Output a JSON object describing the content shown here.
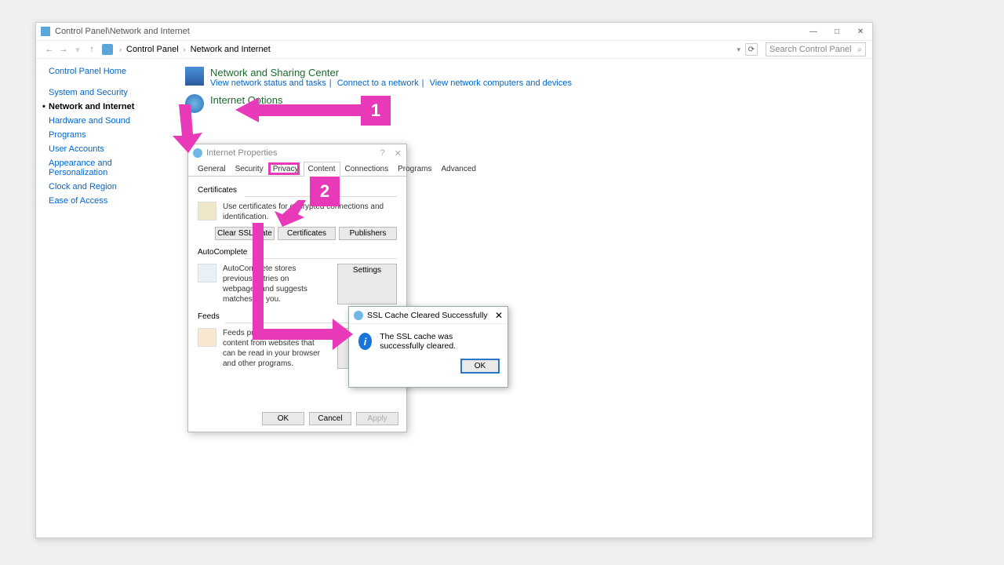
{
  "window": {
    "title": "Control Panel\\Network and Internet",
    "min": "—",
    "max": "□",
    "close": "✕"
  },
  "nav": {
    "back": "←",
    "fwd": "→",
    "up": "↑",
    "crumb1": "Control Panel",
    "crumb2": "Network and Internet",
    "sep": "›",
    "dropdown": "▾",
    "refresh": "⟳",
    "search_placeholder": "Search Control Panel",
    "search_icon": "🔍"
  },
  "sidebar": {
    "home": "Control Panel Home",
    "items": [
      "System and Security",
      "Network and Internet",
      "Hardware and Sound",
      "Programs",
      "User Accounts",
      "Appearance and Personalization",
      "Clock and Region",
      "Ease of Access"
    ]
  },
  "groups": {
    "g1": {
      "title": "Network and Sharing Center",
      "l1": "View network status and tasks",
      "l2": "Connect to a network",
      "l3": "View network computers and devices"
    },
    "g2": {
      "title": "Internet Options"
    }
  },
  "ip": {
    "title": "Internet Properties",
    "help": "?",
    "close": "✕",
    "tabs": [
      "General",
      "Security",
      "Privacy",
      "Content",
      "Connections",
      "Programs",
      "Advanced"
    ],
    "sect_cert": "Certificates",
    "cert_text": "Use certificates for encrypted connections and identification.",
    "btn_clear": "Clear SSL state",
    "btn_cert": "Certificates",
    "btn_pub": "Publishers",
    "sect_ac": "AutoComplete",
    "ac_text": "AutoComplete stores previous entries on webpages and suggests matches for you.",
    "btn_settings": "Settings",
    "sect_feeds": "Feeds",
    "feeds_text": "Feeds provide updated content from websites that can be read in your browser and other programs.",
    "ok": "OK",
    "cancel": "Cancel",
    "apply": "Apply"
  },
  "msg": {
    "title": "SSL Cache Cleared Successfully",
    "text": "The SSL cache was successfully cleared.",
    "ok": "OK",
    "close": "✕"
  },
  "anno": {
    "n1": "1",
    "n2": "2"
  }
}
